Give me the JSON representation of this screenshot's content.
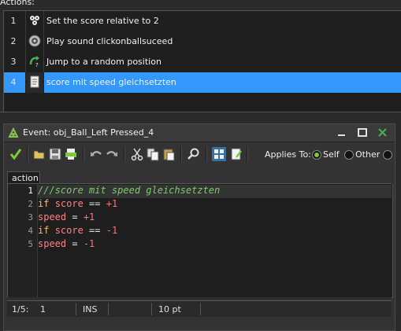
{
  "actions": {
    "header": "Actions:",
    "items": [
      {
        "num": "1",
        "label": "Set the score relative to 2",
        "icon": "score-icon"
      },
      {
        "num": "2",
        "label": "Play sound clickonballsuceed",
        "icon": "speaker-icon"
      },
      {
        "num": "3",
        "label": "Jump to a random position",
        "icon": "random-jump-icon"
      },
      {
        "num": "4",
        "label": "score mit speed gleichsetzten",
        "icon": "script-icon",
        "selected": true
      }
    ]
  },
  "event_window": {
    "title": "Event: obj_Ball_Left Pressed_4",
    "applies_to_label": "Applies To:",
    "applies_options": [
      "Self",
      "Other"
    ],
    "applies_selected": "Self",
    "tab": "action",
    "code_lines": [
      {
        "num": "1",
        "text": "///score mit speed gleichsetzten"
      },
      {
        "num": "2",
        "text": "if score == +1"
      },
      {
        "num": "3",
        "text": "speed = +1"
      },
      {
        "num": "4",
        "text": "if score == -1"
      },
      {
        "num": "5",
        "text": "speed = -1"
      }
    ],
    "status": {
      "line_col": "1/5:",
      "column": "1",
      "mode": "INS",
      "font_size": "10 pt"
    }
  },
  "colors": {
    "selection": "#3399ff",
    "comment": "#7ccc6a",
    "keyword": "#ffb86c",
    "variable": "#ff8080",
    "check": "#7ccc3a"
  }
}
